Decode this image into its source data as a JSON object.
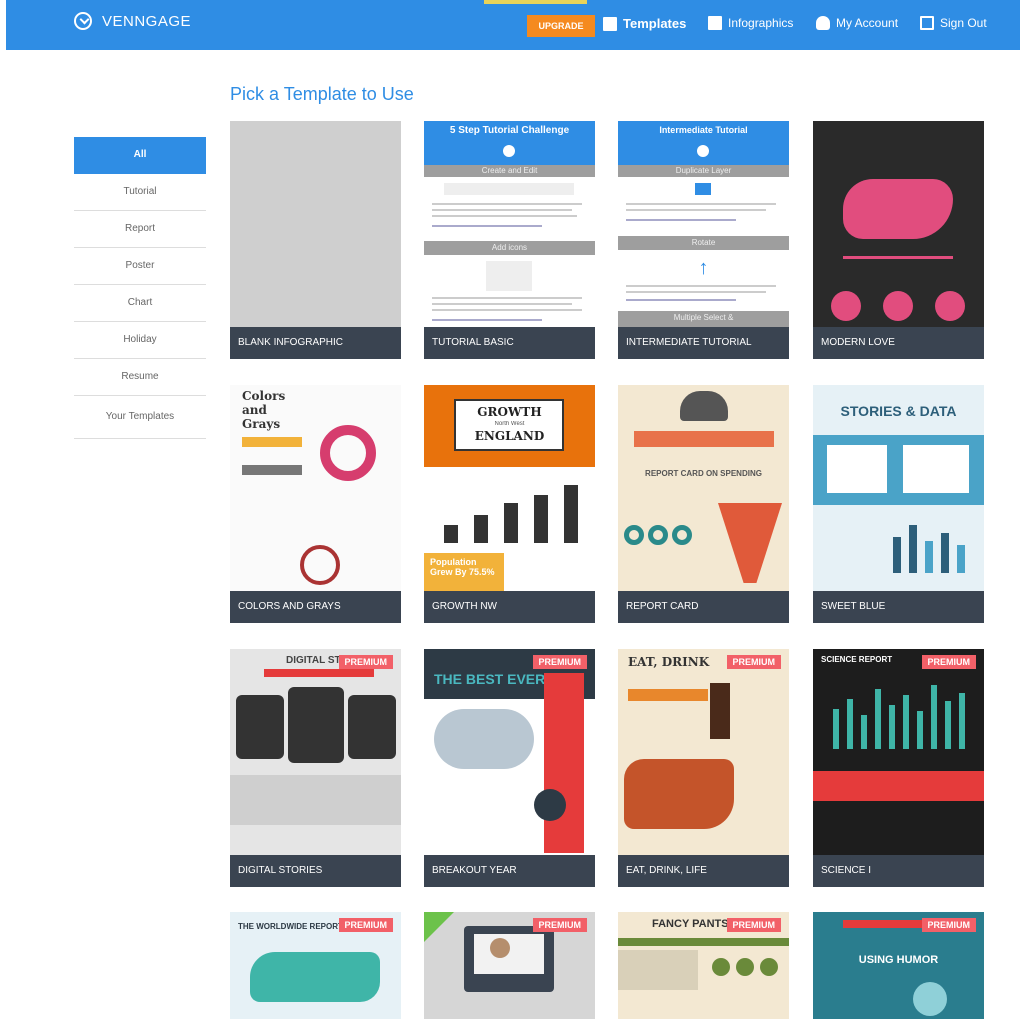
{
  "header": {
    "logo": "VENNGAGE",
    "upgrade": "UPGRADE",
    "nav": [
      {
        "label": "Templates",
        "icon": "templates-icon"
      },
      {
        "label": "Infographics",
        "icon": "infographics-icon"
      },
      {
        "label": "My Account",
        "icon": "account-icon"
      },
      {
        "label": "Sign Out",
        "icon": "sign-out-icon"
      }
    ]
  },
  "page": {
    "heading": "Pick a Template to Use"
  },
  "sidebar": {
    "items": [
      "All",
      "Tutorial",
      "Report",
      "Poster",
      "Chart",
      "Holiday",
      "Resume",
      "Your Templates"
    ],
    "active": "All"
  },
  "templates": [
    {
      "label": "BLANK INFOGRAPHIC"
    },
    {
      "label": "TUTORIAL BASIC",
      "thumb_title": "5 Step Tutorial Challenge",
      "thumb_sections": [
        "Create and Edit",
        "Add icons"
      ]
    },
    {
      "label": "INTERMEDIATE TUTORIAL",
      "thumb_title": "Intermediate Tutorial",
      "thumb_sections": [
        "Duplicate Layer",
        "Rotate",
        "Multiple Select &"
      ]
    },
    {
      "label": "MODERN LOVE"
    },
    {
      "label": "COLORS AND GRAYS",
      "thumb_title": "Colors and Grays"
    },
    {
      "label": "GROWTH NW",
      "thumb_title": "GROWTH",
      "thumb_sub": "North West",
      "thumb_title2": "ENGLAND",
      "thumb_stat": "Population Grew By 75.5%"
    },
    {
      "label": "REPORT CARD",
      "thumb_title": "REPORT CARD ON SPENDING"
    },
    {
      "label": "SWEET BLUE",
      "thumb_title": "STORIES & DATA"
    },
    {
      "label": "DIGITAL STORIES",
      "thumb_title": "DIGITAL STORI",
      "premium": "PREMIUM"
    },
    {
      "label": "BREAKOUT YEAR",
      "thumb_title": "THE BEST EVER",
      "premium": "PREMIUM"
    },
    {
      "label": "EAT, DRINK, LIFE",
      "thumb_title": "EAT, DRINK",
      "premium": "PREMIUM"
    },
    {
      "label": "SCIENCE I",
      "thumb_title": "SCIENCE REPORT",
      "premium": "PREMIUM"
    },
    {
      "label": "",
      "thumb_title": "THE WORLDWIDE REPORT",
      "premium": "PREMIUM"
    },
    {
      "label": "",
      "premium": "PREMIUM"
    },
    {
      "label": "",
      "thumb_title": "FANCY PANTS R",
      "premium": "PREMIUM"
    },
    {
      "label": "",
      "thumb_title": "USING HUMOR",
      "premium": "PREMIUM"
    }
  ],
  "colors": {
    "brand": "#2f8de4",
    "upgrade": "#f58a1f",
    "label_bg": "#3a4451",
    "premium": "#f26068"
  }
}
